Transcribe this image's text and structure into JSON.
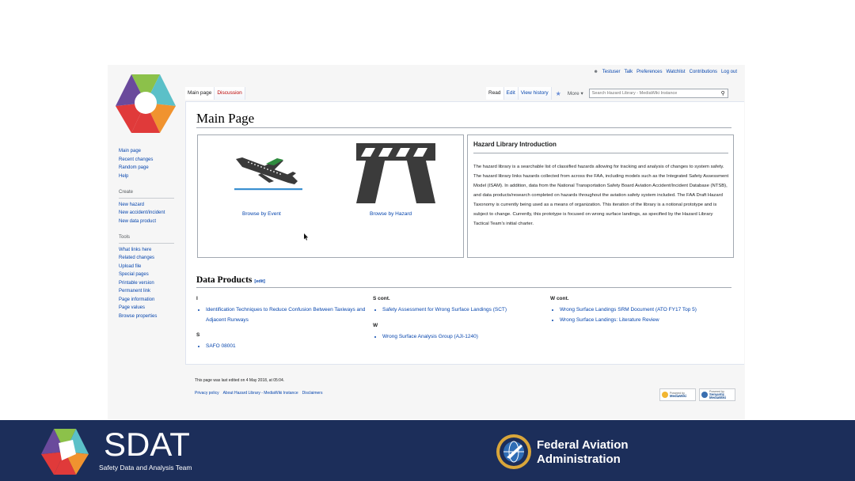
{
  "personal_tools": [
    "Testuser",
    "Talk",
    "Preferences",
    "Watchlist",
    "Contributions",
    "Log out"
  ],
  "tabs": {
    "main_page": "Main page",
    "discussion": "Discussion",
    "read": "Read",
    "edit": "Edit",
    "view_history": "View history",
    "more": "More ▾"
  },
  "search": {
    "placeholder": "Search Hazard Library - MediaWiki Instance"
  },
  "sidebar": {
    "navigation": [
      "Main page",
      "Recent changes",
      "Random page",
      "Help"
    ],
    "create_heading": "Create",
    "create": [
      "New hazard",
      "New accident/incident",
      "New data product"
    ],
    "tools_heading": "Tools",
    "tools": [
      "What links here",
      "Related changes",
      "Upload file",
      "Special pages",
      "Printable version",
      "Permanent link",
      "Page information",
      "Page values",
      "Browse properties"
    ]
  },
  "page": {
    "title": "Main Page",
    "browse_event": "Browse by Event",
    "browse_hazard": "Browse by Hazard",
    "intro_title": "Hazard Library Introduction",
    "intro_text": "The hazard library is a searchable list of classified hazards allowing for tracking and analysis of changes to system safety. The hazard library links hazards collected from across the FAA, including models such as the Integrated Safety Assessment Model (ISAM). In addition, data from the National Transportation Safety Board Aviation Accident/Incident Database (NTSB), and data products/research completed on hazards throughout the aviation safety system included. The FAA Draft Hazard Taxonomy is currently being used as a means of organization. This iteration of the library is a notional prototype and is subject to change. Currently, this prototype is focused on wrong surface landings, as specified by the Hazard Library Tactical Team's initial charter.",
    "data_products_heading": "Data Products",
    "edit_link": "[edit]",
    "columns": [
      {
        "groups": [
          {
            "letter": "I",
            "items": [
              "Identification Techniques to Reduce Confusion Between Taxiways and Adjacent Runways"
            ]
          },
          {
            "letter": "S",
            "items": [
              "SAFO 08001"
            ]
          }
        ]
      },
      {
        "groups": [
          {
            "letter": "S cont.",
            "items": [
              "Safety Assessment for Wrong Surface Landings (SCT)"
            ]
          },
          {
            "letter": "W",
            "items": [
              "Wrong Surface Analysis Group (AJI-1240)"
            ]
          }
        ]
      },
      {
        "groups": [
          {
            "letter": "W cont.",
            "items": [
              "Wrong Surface Landings SRM Document (ATO FY17 Top 5)",
              "Wrong Surface Landings: Literature Review"
            ]
          }
        ]
      }
    ]
  },
  "footer": {
    "last_edited": "This page was last edited on 4 May 2018, at 05:04.",
    "links": [
      "Privacy policy",
      "About Hazard Library - MediaWiki Instance",
      "Disclaimers"
    ],
    "badge_1_small": "Powered by",
    "badge_1": "MediaWiki",
    "badge_2_small": "Powered by",
    "badge_2": "Semantic MediaWiki"
  },
  "banner": {
    "sdat_title": "SDAT",
    "sdat_subtitle": "Safety Data and Analysis Team",
    "faa_name": "Federal Aviation\nAdministration"
  },
  "colors": {
    "banner_bg": "#1c2e5a",
    "link": "#0645ad",
    "logo_green": "#8cc14a",
    "logo_teal": "#5bc0c8",
    "logo_orange": "#f0932f",
    "logo_red": "#e03a3a",
    "logo_purple": "#6a4a9c"
  }
}
